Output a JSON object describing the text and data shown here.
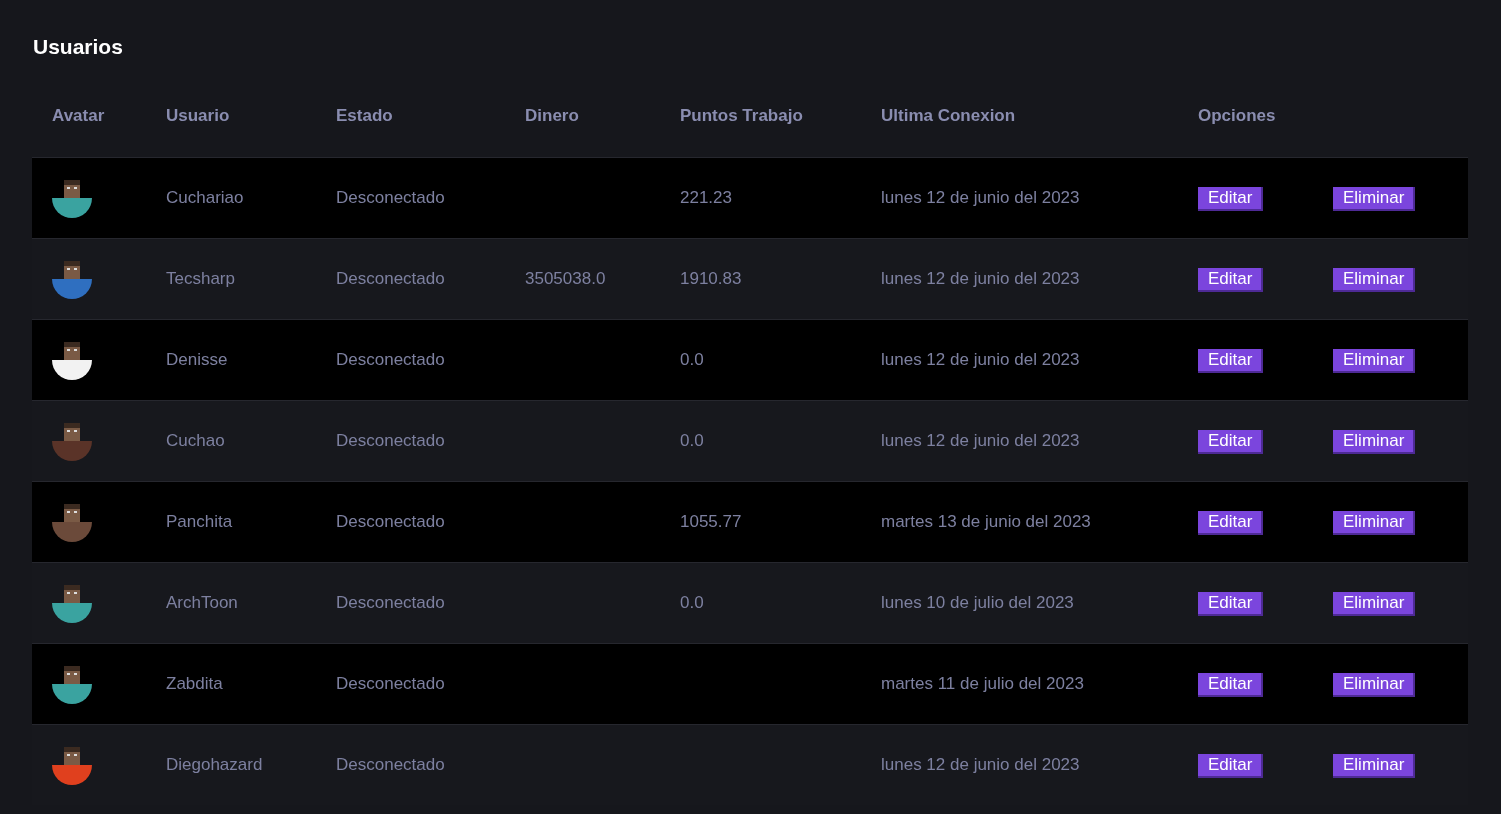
{
  "title": "Usuarios",
  "table": {
    "columns": [
      "Avatar",
      "Usuario",
      "Estado",
      "Dinero",
      "Puntos Trabajo",
      "Ultima Conexion",
      "Opciones"
    ],
    "rows": [
      {
        "color": "#3aa3a0",
        "user": "Cuchariao",
        "status": "Desconectado",
        "money": "",
        "points": "221.23",
        "last": "lunes 12 de junio del 2023",
        "edit": "Editar",
        "delete": "Eliminar"
      },
      {
        "color": "#2f6fc0",
        "user": "Tecsharp",
        "status": "Desconectado",
        "money": "3505038.0",
        "points": "1910.83",
        "last": "lunes 12 de junio del 2023",
        "edit": "Editar",
        "delete": "Eliminar"
      },
      {
        "color": "#f2f2f2",
        "user": "Denisse",
        "status": "Desconectado",
        "money": "",
        "points": "0.0",
        "last": "lunes 12 de junio del 2023",
        "edit": "Editar",
        "delete": "Eliminar"
      },
      {
        "color": "#5a3328",
        "user": "Cuchao",
        "status": "Desconectado",
        "money": "",
        "points": "0.0",
        "last": "lunes 12 de junio del 2023",
        "edit": "Editar",
        "delete": "Eliminar"
      },
      {
        "color": "#6b4a3a",
        "user": "Panchita",
        "status": "Desconectado",
        "money": "",
        "points": "1055.77",
        "last": "martes 13 de junio del 2023",
        "edit": "Editar",
        "delete": "Eliminar"
      },
      {
        "color": "#3aa3a0",
        "user": "ArchToon",
        "status": "Desconectado",
        "money": "",
        "points": "0.0",
        "last": "lunes 10 de julio del 2023",
        "edit": "Editar",
        "delete": "Eliminar"
      },
      {
        "color": "#3aa3a0",
        "user": "Zabdita",
        "status": "Desconectado",
        "money": "",
        "points": "",
        "last": "martes 11 de julio del 2023",
        "edit": "Editar",
        "delete": "Eliminar"
      },
      {
        "color": "#e0401e",
        "user": "Diegohazard",
        "status": "Desconectado",
        "money": "",
        "points": "",
        "last": "lunes 12 de junio del 2023",
        "edit": "Editar",
        "delete": "Eliminar"
      }
    ]
  }
}
